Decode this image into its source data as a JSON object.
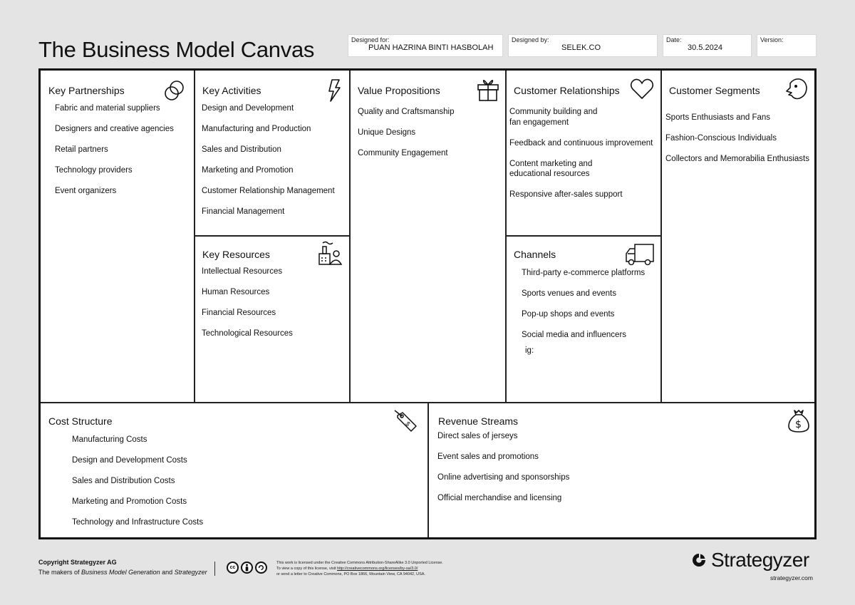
{
  "header": {
    "title": "The Business Model Canvas",
    "designed_for": {
      "label": "Designed for:",
      "value": "PUAN HAZRINA BINTI HASBOLAH"
    },
    "designed_by": {
      "label": "Designed by:",
      "value": "SELEK.CO"
    },
    "date": {
      "label": "Date:",
      "value": "30.5.2024"
    },
    "version": {
      "label": "Version:",
      "value": ""
    }
  },
  "canvas": {
    "key_partnerships": {
      "title": "Key Partnerships",
      "icon": "link-icon",
      "items": [
        "Fabric and material suppliers",
        "Designers and creative agencies",
        "Retail partners",
        "Technology providers",
        "Event organizers"
      ]
    },
    "key_activities": {
      "title": "Key Activities",
      "icon": "lightning-icon",
      "items": [
        "Design and Development",
        "Manufacturing and Production",
        "Sales and Distribution",
        "Marketing and Promotion",
        "Customer Relationship Management",
        "Financial Management"
      ]
    },
    "key_resources": {
      "title": "Key Resources",
      "icon": "factory-person-icon",
      "items": [
        "Intellectual Resources",
        "Human Resources",
        "Financial Resources",
        "Technological Resources"
      ]
    },
    "value_propositions": {
      "title": "Value Propositions",
      "icon": "gift-icon",
      "items": [
        "Quality and Craftsmanship",
        "Unique Designs",
        "Community Engagement"
      ]
    },
    "customer_relationships": {
      "title": "Customer Relationships",
      "icon": "heart-icon",
      "items": [
        "Community building and\nfan engagement",
        "Feedback and continuous improvement",
        "Content marketing and\neducational resources",
        "Responsive after-sales support"
      ]
    },
    "channels": {
      "title": "Channels",
      "icon": "truck-icon",
      "items": [
        "Third-party e-commerce platforms",
        "Sports venues and events",
        "Pop-up shops and events",
        "Social media and influencers"
      ],
      "extra": "ig:"
    },
    "customer_segments": {
      "title": "Customer Segments",
      "icon": "face-icon",
      "items": [
        "Sports Enthusiasts and Fans",
        "Fashion-Conscious Individuals",
        "Collectors and Memorabilia Enthusiasts"
      ]
    },
    "cost_structure": {
      "title": "Cost Structure",
      "icon": "price-tag-icon",
      "items": [
        "Manufacturing Costs",
        "Design and Development Costs",
        "Sales and Distribution Costs",
        "Marketing and Promotion Costs",
        "Technology and Infrastructure Costs"
      ]
    },
    "revenue_streams": {
      "title": "Revenue Streams",
      "icon": "money-bag-icon",
      "items": [
        "Direct sales of jerseys",
        "Event sales and promotions",
        "Online advertising and sponsorships",
        "Official merchandise and licensing"
      ]
    }
  },
  "footer": {
    "copyright": "Copyright Strategyzer AG",
    "makers_prefix": "The makers of ",
    "makers_book": "Business Model Generation",
    "makers_and": " and ",
    "makers_company": "Strategyzer",
    "license_line1": "This work is licensed under the Creative Commons Attribution-ShareAlike 3.0 Unported License.",
    "license_line2_prefix": "To view a copy of this license, visit ",
    "license_url": "http://creativecommons.org/licenses/by-sa/3.0/",
    "license_line3": "or send a letter to Creative Commons, PO Box 1866, Mountain View, CA 94042, USA.",
    "cc_icons": [
      "cc",
      "by",
      "sa"
    ],
    "brand_name": "Strategyzer",
    "brand_url": "strategyzer.com"
  }
}
